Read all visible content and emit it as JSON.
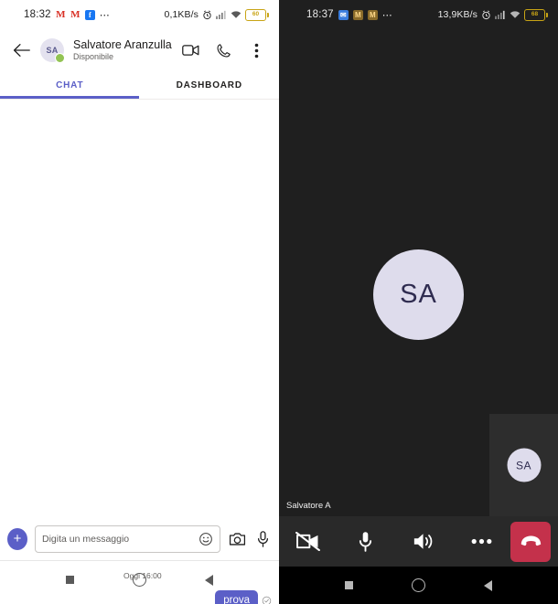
{
  "left_phone": {
    "status_bar": {
      "time": "18:32",
      "icons": [
        "gmail-icon",
        "gmail-icon",
        "facebook-icon",
        "overflow-dots-icon"
      ],
      "network_speed": "0,1KB/s",
      "right_icons": [
        "alarm-icon",
        "signal-icon",
        "wifi-icon"
      ],
      "battery_level": "60"
    },
    "header": {
      "back_label": "back-arrow",
      "avatar_initials": "SA",
      "contact_name": "Salvatore Aranzulla",
      "presence_status": "Disponibile",
      "presence_color": "#92c353",
      "actions": [
        "video-call-icon",
        "audio-call-icon",
        "more-options-icon"
      ]
    },
    "tabs": [
      {
        "label": "CHAT",
        "active": true
      },
      {
        "label": "DASHBOARD",
        "active": false
      }
    ],
    "accent_color": "#5b5fc7",
    "conversation": {
      "day_divider": "Oggi 16:00",
      "messages": [
        {
          "text": "prova",
          "outgoing": true,
          "status": "sent"
        }
      ]
    },
    "compose": {
      "add_label": "+",
      "placeholder": "Digita un messaggio",
      "input_value": "",
      "icons": [
        "emoji-icon",
        "camera-icon",
        "microphone-icon"
      ]
    },
    "nav_bar": [
      "recents-square-icon",
      "home-circle-icon",
      "back-triangle-icon"
    ]
  },
  "right_phone": {
    "status_bar": {
      "time": "18:37",
      "icons": [
        "app-icon",
        "gmail-icon",
        "gmail-icon",
        "overflow-dots-icon"
      ],
      "network_speed": "13,9KB/s",
      "right_icons": [
        "alarm-icon",
        "signal-icon",
        "wifi-icon"
      ],
      "battery_level": "68"
    },
    "call": {
      "avatar_initials": "SA",
      "avatar_bg": "#dedcec",
      "caller_name": "Salvatore A",
      "self_view_initials": "SA",
      "background_color": "#1f1f1f",
      "controls": [
        {
          "name": "video-off-icon",
          "state": "off"
        },
        {
          "name": "microphone-icon",
          "state": "on"
        },
        {
          "name": "speaker-icon",
          "state": "on"
        },
        {
          "name": "more-options-icon",
          "state": "on"
        },
        {
          "name": "hangup-icon",
          "state": "end",
          "color": "#c4314b"
        }
      ]
    },
    "nav_bar": [
      "recents-square-icon",
      "home-circle-icon",
      "back-triangle-icon"
    ]
  }
}
